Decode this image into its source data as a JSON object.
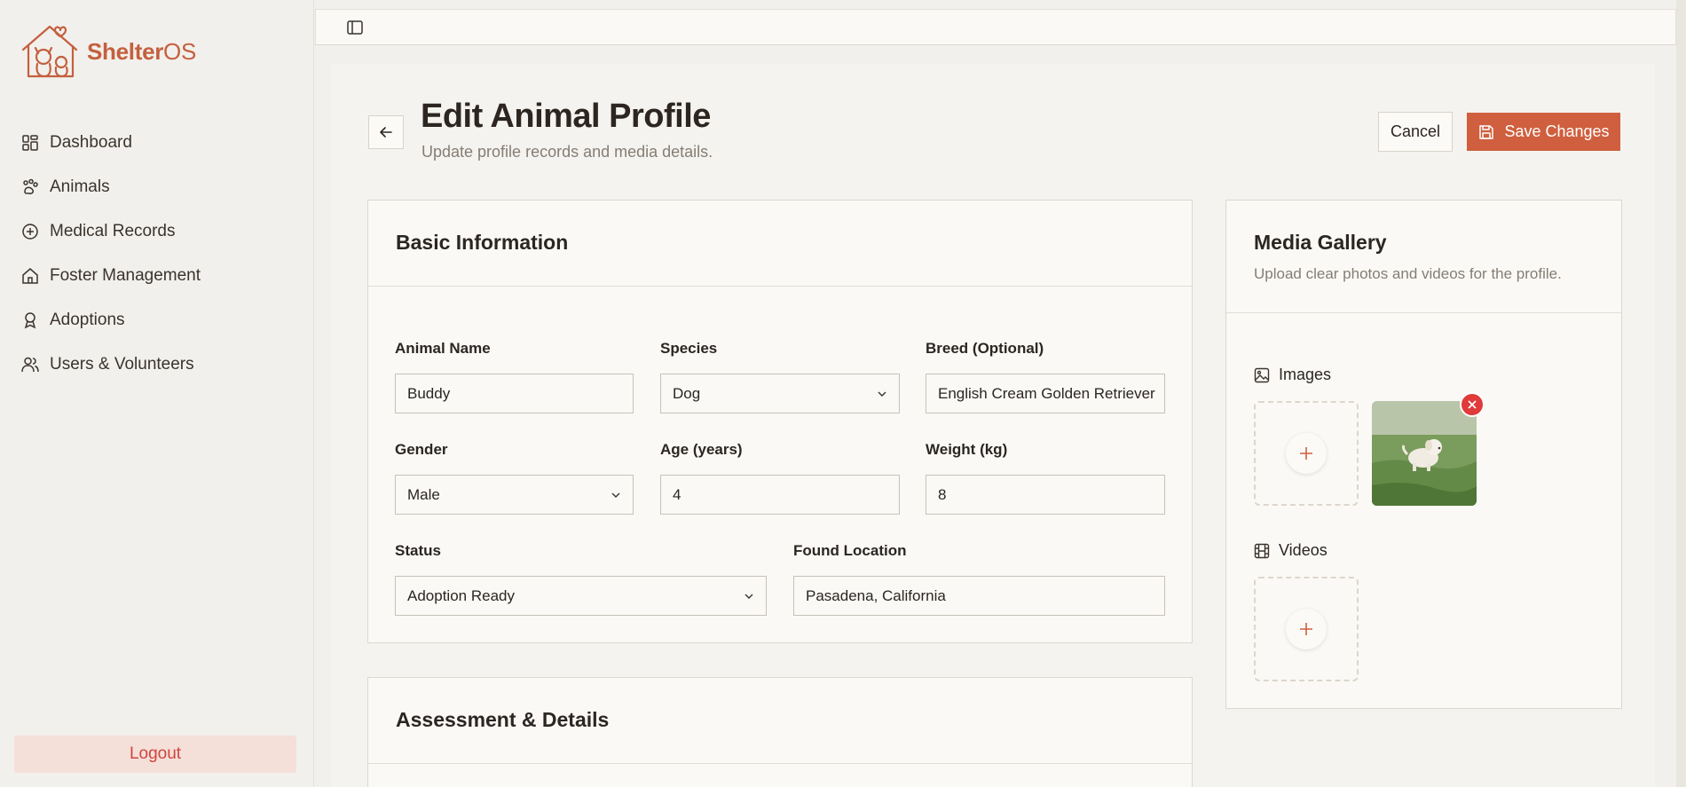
{
  "brand": {
    "name_a": "Shelter",
    "name_b": "OS"
  },
  "sidebar": {
    "items": [
      {
        "label": "Dashboard",
        "icon": "grid-icon"
      },
      {
        "label": "Animals",
        "icon": "paw-icon"
      },
      {
        "label": "Medical Records",
        "icon": "plus-circle-icon"
      },
      {
        "label": "Foster Management",
        "icon": "home-icon"
      },
      {
        "label": "Adoptions",
        "icon": "award-icon"
      },
      {
        "label": "Users & Volunteers",
        "icon": "users-icon"
      }
    ],
    "logout": "Logout"
  },
  "header": {
    "title": "Edit Animal Profile",
    "subtitle": "Update profile records and media details.",
    "cancel": "Cancel",
    "save": "Save Changes"
  },
  "basic": {
    "title": "Basic Information",
    "fields": {
      "name": {
        "label": "Animal Name",
        "value": "Buddy"
      },
      "species": {
        "label": "Species",
        "value": "Dog"
      },
      "breed": {
        "label": "Breed (Optional)",
        "value": "English Cream Golden Retriever"
      },
      "gender": {
        "label": "Gender",
        "value": "Male"
      },
      "age": {
        "label": "Age (years)",
        "value": "4"
      },
      "weight": {
        "label": "Weight (kg)",
        "value": "8"
      },
      "status": {
        "label": "Status",
        "value": "Adoption Ready"
      },
      "location": {
        "label": "Found Location",
        "value": "Pasadena, California"
      }
    }
  },
  "assessment": {
    "title": "Assessment & Details"
  },
  "gallery": {
    "title": "Media Gallery",
    "subtitle": "Upload clear photos and videos for the profile.",
    "images_label": "Images",
    "videos_label": "Videos"
  },
  "colors": {
    "accent": "#cf5f3e",
    "danger": "#e03a3a",
    "logout_bg": "#f5dfd9"
  }
}
